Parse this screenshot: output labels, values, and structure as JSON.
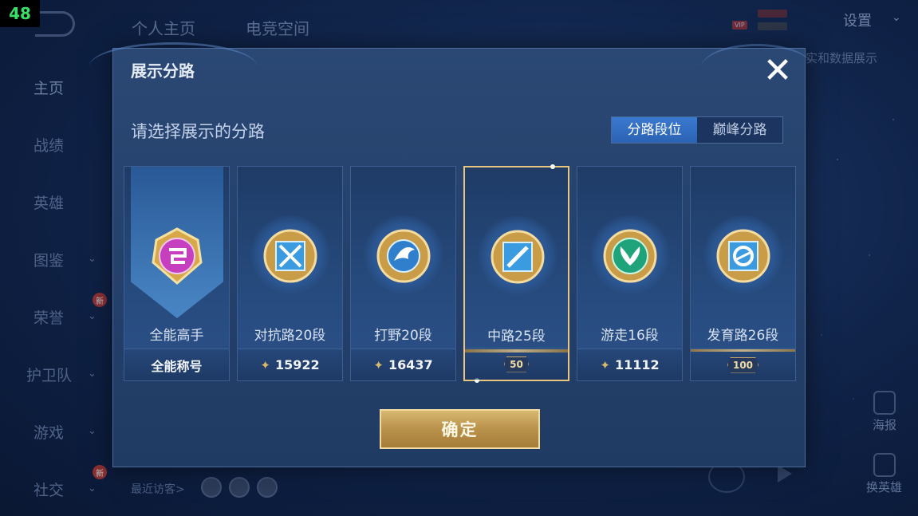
{
  "overlay": {
    "counter": "48"
  },
  "header": {
    "tabs": [
      "个人主页",
      "电竞空间"
    ],
    "settings_label": "设置",
    "vip_badge": "VIP",
    "background_text": "实和数据展示"
  },
  "sidebar": {
    "items": [
      {
        "label": "主页"
      },
      {
        "label": "战绩"
      },
      {
        "label": "英雄"
      },
      {
        "label": "图鉴"
      },
      {
        "label": "荣誉"
      },
      {
        "label": "护卫队"
      },
      {
        "label": "游戏"
      },
      {
        "label": "社交"
      }
    ],
    "new_badge": "新"
  },
  "bottom": {
    "visitors_label": "最近访客>",
    "poster_label": "海报",
    "change_hero_label": "换英雄"
  },
  "modal": {
    "title": "展示分路",
    "close_glyph": "✕",
    "subtitle": "请选择展示的分路",
    "segments": [
      "分路段位",
      "巅峰分路"
    ],
    "selected_segment": "分路段位",
    "confirm_label": "确定",
    "cards": [
      {
        "label": "全能高手",
        "footer": "全能称号",
        "emblem": "all-rounder-emblem-icon",
        "color": "#c63fbf"
      },
      {
        "label": "对抗路20段",
        "points": "15922",
        "emblem": "clash-lane-emblem-icon",
        "color": "#3a9be0"
      },
      {
        "label": "打野20段",
        "points": "16437",
        "emblem": "jungle-emblem-icon",
        "color": "#3a9be0"
      },
      {
        "label": "中路25段",
        "badge": "50",
        "emblem": "mid-lane-emblem-icon",
        "color": "#3a9be0",
        "selected": true
      },
      {
        "label": "游走16段",
        "points": "11112",
        "emblem": "roam-emblem-icon",
        "color": "#1fa37a"
      },
      {
        "label": "发育路26段",
        "badge": "100",
        "emblem": "farm-lane-emblem-icon",
        "color": "#3a9be0"
      }
    ]
  }
}
